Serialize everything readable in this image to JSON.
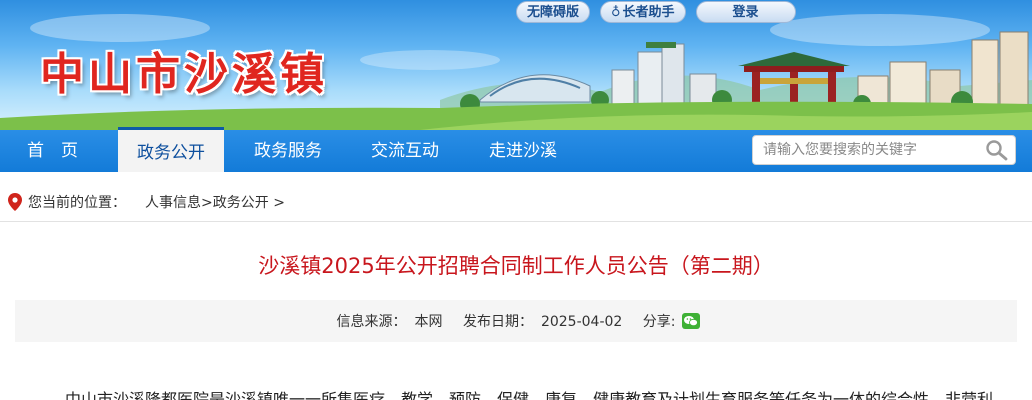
{
  "header": {
    "site_title": "中山市沙溪镇",
    "top_links": {
      "accessibility": "无障碍版",
      "elder_helper": "长者助手",
      "login": "登录"
    }
  },
  "nav": {
    "items": [
      {
        "label": "首　页"
      },
      {
        "label": "政务公开",
        "active": true
      },
      {
        "label": "政务服务"
      },
      {
        "label": "交流互动"
      },
      {
        "label": "走进沙溪"
      }
    ],
    "search_placeholder": "请输入您要搜索的关键字"
  },
  "breadcrumb": {
    "label": "您当前的位置：",
    "items": [
      "人事信息",
      "政务公开"
    ],
    "separator": ">"
  },
  "article": {
    "title": "沙溪镇2025年公开招聘合同制工作人员公告（第二期）",
    "meta": {
      "source_label": "信息来源：",
      "source": "本网",
      "date_label": "发布日期：",
      "date": "2025-04-02",
      "share_label": "分享:"
    },
    "body_first_line": "中山市沙溪隆都医院是沙溪镇唯一一所集医疗、教学、预防、保健、康复、健康教育及计划生育服务等任务为一体的综合性、非营利"
  },
  "colors": {
    "title_red": "#e0261f",
    "nav_blue": "#137bd8",
    "article_title_red": "#c8161d"
  }
}
